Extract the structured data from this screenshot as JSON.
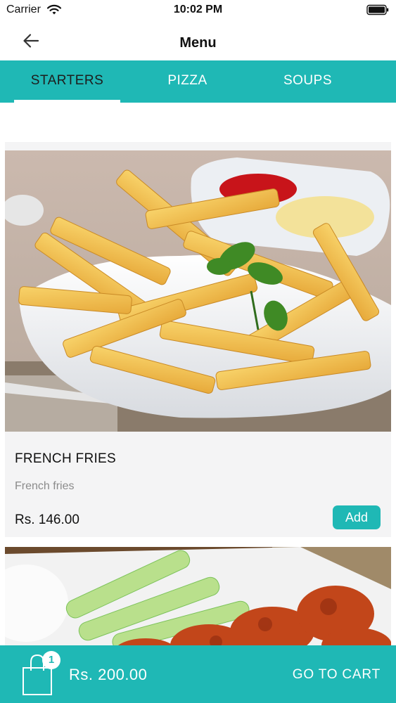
{
  "status_bar": {
    "carrier": "Carrier",
    "time": "10:02 PM",
    "icons": [
      "wifi-icon",
      "battery-icon"
    ]
  },
  "nav": {
    "title": "Menu",
    "back_icon": "arrow-left-icon"
  },
  "tabs": [
    {
      "label": "STARTERS",
      "active": true
    },
    {
      "label": "PIZZA",
      "active": false
    },
    {
      "label": "SOUPS",
      "active": false
    }
  ],
  "items": [
    {
      "name": "FRENCH FRIES",
      "description": "French fries",
      "price": "Rs. 146.00",
      "add_label": "Add",
      "image": "french-fries-photo"
    },
    {
      "image": "chicken-wings-photo"
    }
  ],
  "cart": {
    "count": "1",
    "total": "Rs. 200.00",
    "action_label": "GO TO CART",
    "icon": "shopping-bag-icon"
  },
  "colors": {
    "accent": "#1fb8b5",
    "card_bg": "#f4f4f5",
    "muted_text": "#8b8b8b"
  }
}
